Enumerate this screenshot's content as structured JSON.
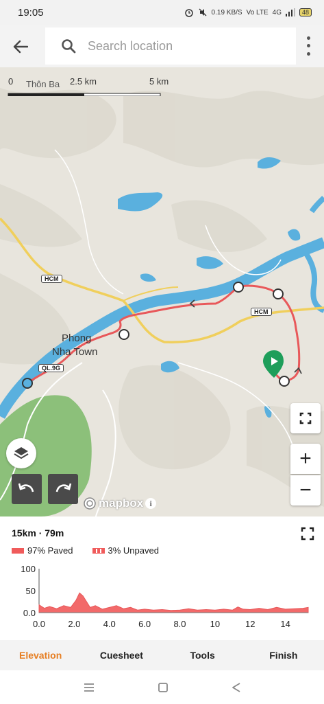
{
  "status_bar": {
    "time": "19:05",
    "net_speed": "0.19 KB/S",
    "network_label": "Vo LTE",
    "signal_label": "4G",
    "battery": "48",
    "icons": [
      "alarm-icon",
      "mute-icon",
      "signal-icon",
      "battery-icon"
    ]
  },
  "app_bar": {
    "back_icon": "arrow-left-icon",
    "search_placeholder": "Search location",
    "search_value": "",
    "more_icon": "more-vert-icon"
  },
  "map": {
    "scale": {
      "zero": "0",
      "mid": "2.5 km",
      "max": "5 km"
    },
    "place_labels": {
      "thon_ba": "Thôn Ba",
      "phong_nha_1": "Phong",
      "phong_nha_2": "Nha Town"
    },
    "road_shields": {
      "hcm_1": "HCM",
      "hcm_2": "HCM",
      "ql": "QL.9G"
    },
    "attribution": "mapbox",
    "buttons": {
      "layers_icon": "layers-icon",
      "fullscreen_icon": "fullscreen-icon",
      "zoom_in": "+",
      "zoom_out": "−",
      "undo_icon": "undo-icon",
      "redo_icon": "redo-icon"
    },
    "colors": {
      "route": "#e8585a",
      "water": "#5ab0de",
      "road": "#f0cf5c",
      "forest": "#8cc07a",
      "start_pin": "#1e9e5a"
    }
  },
  "elevation_panel": {
    "stats": "15km · 79m",
    "legend": [
      {
        "label": "97% Paved",
        "color": "#f05b5b"
      },
      {
        "label": "3% Unpaved",
        "color": "#f05b5b"
      }
    ],
    "expand_icon": "fullscreen-icon"
  },
  "chart_data": {
    "type": "area",
    "title": "",
    "xlabel": "",
    "ylabel": "",
    "xlim": [
      0,
      15.3
    ],
    "ylim": [
      0,
      100
    ],
    "x_ticks": [
      "0.0",
      "2.0",
      "4.0",
      "6.0",
      "8.0",
      "10",
      "12",
      "14"
    ],
    "y_ticks": [
      "0.0",
      "50",
      "100"
    ],
    "series": [
      {
        "x": [
          0,
          0.3,
          0.6,
          1.0,
          1.4,
          1.8,
          2.1,
          2.3,
          2.5,
          2.7,
          2.9,
          3.2,
          3.6,
          4.0,
          4.4,
          4.8,
          5.2,
          5.6,
          6.0,
          6.5,
          7.0,
          7.5,
          8.0,
          8.5,
          9.0,
          9.5,
          10.0,
          10.5,
          11.0,
          11.3,
          11.6,
          12.0,
          12.5,
          13.0,
          13.5,
          14.0,
          14.5,
          15.0,
          15.3
        ],
        "y": [
          18,
          10,
          14,
          9,
          16,
          12,
          28,
          45,
          38,
          25,
          12,
          16,
          8,
          12,
          16,
          9,
          12,
          6,
          8,
          6,
          7,
          5,
          6,
          9,
          6,
          7,
          6,
          8,
          6,
          13,
          8,
          7,
          10,
          7,
          12,
          8,
          9,
          10,
          12
        ]
      }
    ],
    "grid": false
  },
  "tabs": [
    {
      "label": "Elevation",
      "active": true
    },
    {
      "label": "Cuesheet",
      "active": false
    },
    {
      "label": "Tools",
      "active": false
    },
    {
      "label": "Finish",
      "active": false
    }
  ],
  "nav_bar": {
    "icons": [
      "menu-icon",
      "home-icon",
      "back-triangle-icon"
    ]
  }
}
